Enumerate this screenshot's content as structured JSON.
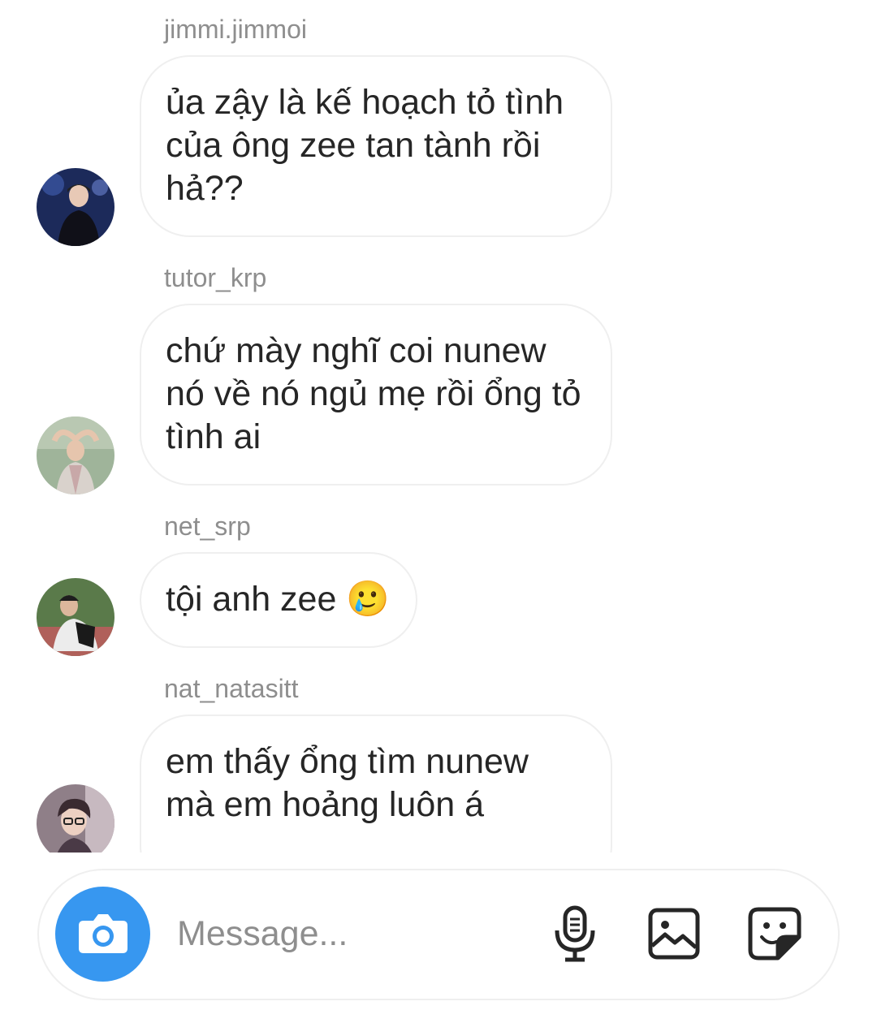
{
  "messages": [
    {
      "username": "jimmi.jimmoi",
      "text": "ủa zậy là kế hoạch tỏ tình của ông zee tan tành rồi hả??"
    },
    {
      "username": "tutor_krp",
      "text": "chứ mày nghĩ coi nunew nó về nó ngủ mẹ rồi ổng tỏ tình ai"
    },
    {
      "username": "net_srp",
      "text": "tội anh zee 🥲"
    },
    {
      "username": "nat_natasitt",
      "text": "em thấy ổng tìm nunew mà em hoảng luôn á"
    }
  ],
  "composer": {
    "placeholder": "Message...",
    "icons": [
      "camera-icon",
      "microphone-icon",
      "gallery-icon",
      "sticker-icon"
    ],
    "camera_color": "#3797f0"
  }
}
